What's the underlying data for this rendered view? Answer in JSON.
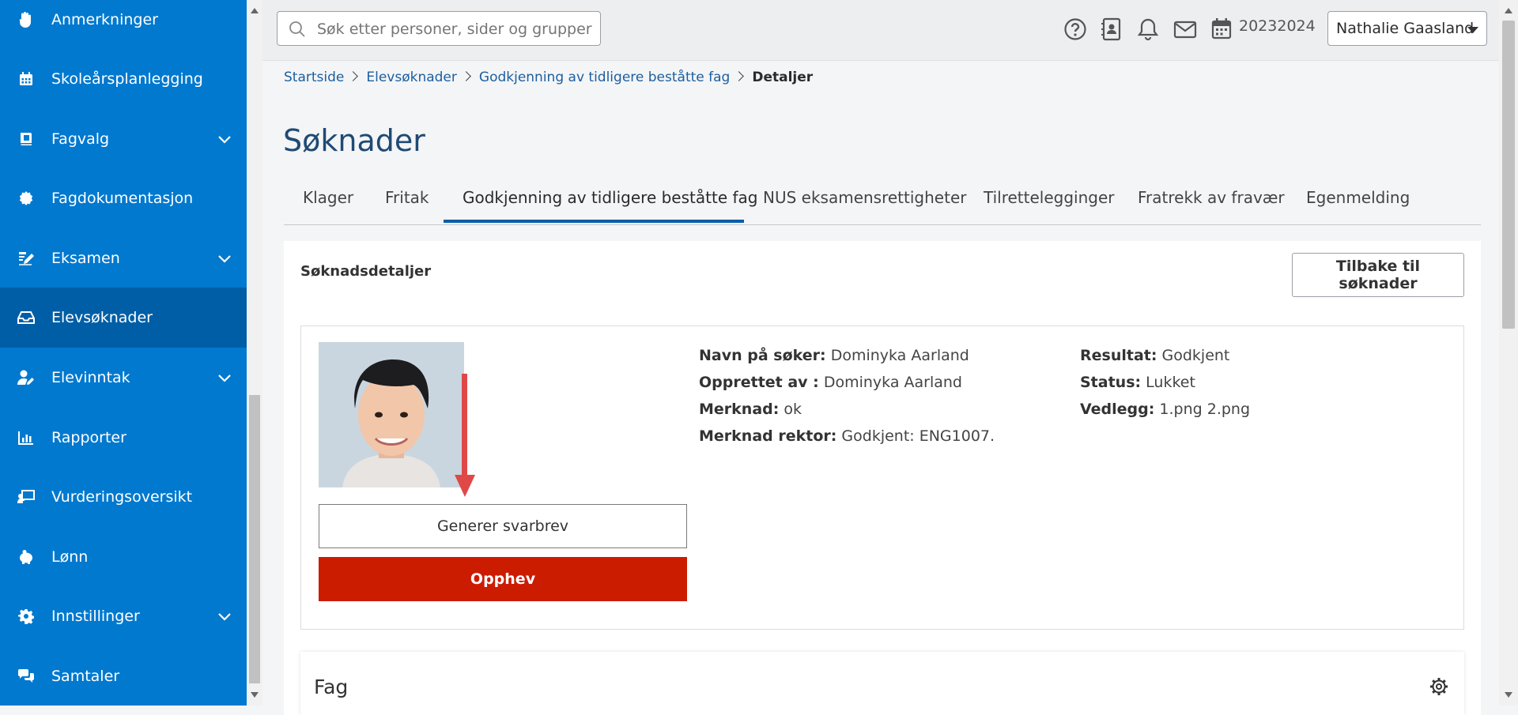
{
  "sidebar": {
    "items": [
      {
        "label": "Anmerkninger",
        "icon": "hand-icon",
        "expandable": false
      },
      {
        "label": "Skoleårsplanlegging",
        "icon": "calendar-icon",
        "expandable": false
      },
      {
        "label": "Fagvalg",
        "icon": "book-icon",
        "expandable": true
      },
      {
        "label": "Fagdokumentasjon",
        "icon": "badge-icon",
        "expandable": false
      },
      {
        "label": "Eksamen",
        "icon": "exam-pen-icon",
        "expandable": true
      },
      {
        "label": "Elevsøknader",
        "icon": "inbox-icon",
        "expandable": false,
        "active": true
      },
      {
        "label": "Elevinntak",
        "icon": "user-edit-icon",
        "expandable": true
      },
      {
        "label": "Rapporter",
        "icon": "bar-chart-icon",
        "expandable": false
      },
      {
        "label": "Vurderingsoversikt",
        "icon": "teacher-board-icon",
        "expandable": false
      },
      {
        "label": "Lønn",
        "icon": "piggy-bank-icon",
        "expandable": false
      },
      {
        "label": "Innstillinger",
        "icon": "gear-icon",
        "expandable": true
      },
      {
        "label": "Samtaler",
        "icon": "chat-icon",
        "expandable": false
      }
    ]
  },
  "topbar": {
    "search_placeholder": "Søk etter personer, sider og grupper",
    "icons": [
      "help-icon",
      "contacts-icon",
      "bell-icon",
      "mail-icon",
      "calendar-icon"
    ],
    "school_year": "20232024",
    "user_name": "Nathalie Gaasland"
  },
  "breadcrumb": {
    "items": [
      "Startside",
      "Elevsøknader",
      "Godkjenning av tidligere beståtte fag"
    ],
    "current": "Detaljer"
  },
  "page": {
    "title": "Søknader",
    "tabs": [
      "Klager",
      "Fritak",
      "Godkjenning av tidligere beståtte fag",
      "NUS eksamensrettigheter",
      "Tilrettelegginger",
      "Fratrekk av fravær",
      "Egenmelding"
    ],
    "active_tab": "Godkjenning av tidligere beståtte fag"
  },
  "details": {
    "section_title": "Søknadsdetaljer",
    "back_button": "Tilbake til søknader",
    "generate_button": "Generer svarbrev",
    "revoke_button": "Opphev",
    "left_fields": [
      {
        "label": "Navn på søker:",
        "value": "Dominyka Aarland"
      },
      {
        "label": "Opprettet av :",
        "value": "Dominyka Aarland"
      },
      {
        "label": "Merknad:",
        "value": "ok"
      },
      {
        "label": "Merknad rektor:",
        "value": "Godkjent: ENG1007."
      }
    ],
    "right_fields": [
      {
        "label": "Resultat:",
        "value": "Godkjent"
      },
      {
        "label": "Status:",
        "value": "Lukket"
      },
      {
        "label": "Vedlegg:",
        "value": "1.png 2.png"
      }
    ]
  },
  "fag": {
    "title": "Fag"
  },
  "colors": {
    "sidebar": "#0079cf",
    "sidebar_active": "#005ea6",
    "danger": "#cc1c00",
    "annotation_arrow": "#e04848",
    "title": "#1f4a74",
    "link": "#1c5fa0"
  }
}
